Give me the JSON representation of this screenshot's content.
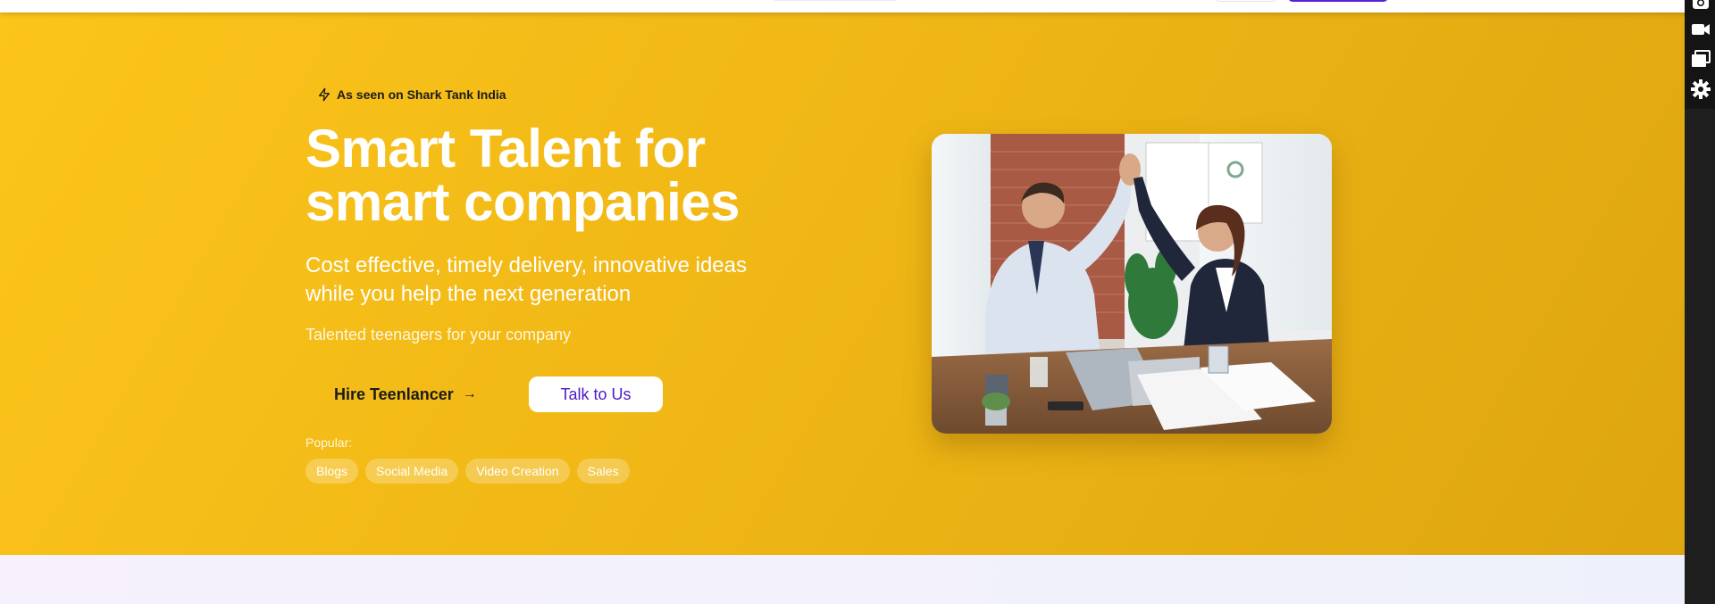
{
  "hero": {
    "badge_text": "As seen on Shark Tank India",
    "headline_line1": "Smart Talent for",
    "headline_line2": "smart companies",
    "subtitle_line1": "Cost effective, timely delivery, innovative ideas",
    "subtitle_line2": "while you help the next generation",
    "tagline": "Talented teenagers for your company",
    "primary_button": "Hire Teenlancer",
    "primary_button_arrow": "→",
    "secondary_button": "Talk to Us",
    "popular_label": "Popular:",
    "popular_tags": [
      "Blogs",
      "Social Media",
      "Video Creation",
      "Sales"
    ]
  },
  "sidebar_tools": [
    "camera-icon",
    "video-icon",
    "window-icon",
    "gear-icon"
  ],
  "colors": {
    "hero_start": "#fcc51a",
    "hero_end": "#dea50f",
    "accent_purple": "#4b19c9",
    "nav_button_purple": "#5a22d6",
    "sidebar": "#1e1e1e"
  }
}
